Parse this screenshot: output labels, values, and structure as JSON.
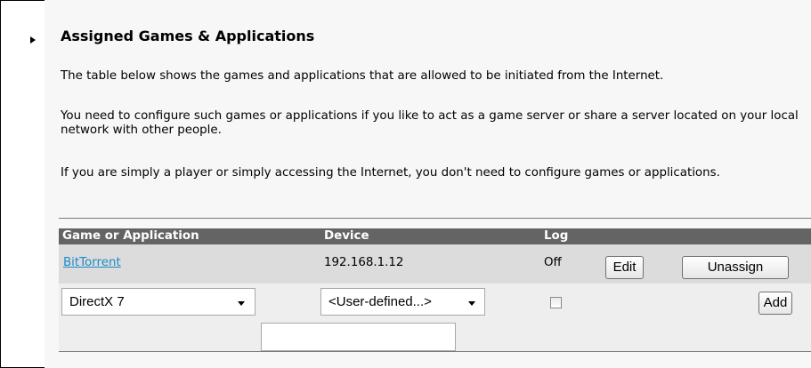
{
  "section": {
    "title": "Assigned Games & Applications",
    "paragraphs": [
      "The table below shows the games and applications that are allowed to be initiated from the Internet.",
      "You need to configure such games or applications if you like to act as a game server or share a server located on your local network with other people.",
      "If you are simply a player or simply accessing the Internet, you don't need to configure games or applications."
    ]
  },
  "table": {
    "headers": [
      "Game or Application",
      "Device",
      "Log"
    ],
    "rows": [
      {
        "application": "BitTorrent",
        "device": "192.168.1.12",
        "log": "Off",
        "edit_label": "Edit",
        "unassign_label": "Unassign"
      }
    ],
    "new_row": {
      "application_selected": "DirectX 7",
      "device_selected": "<User-defined...>",
      "log_checked": false,
      "add_label": "Add",
      "custom_device_value": ""
    }
  }
}
